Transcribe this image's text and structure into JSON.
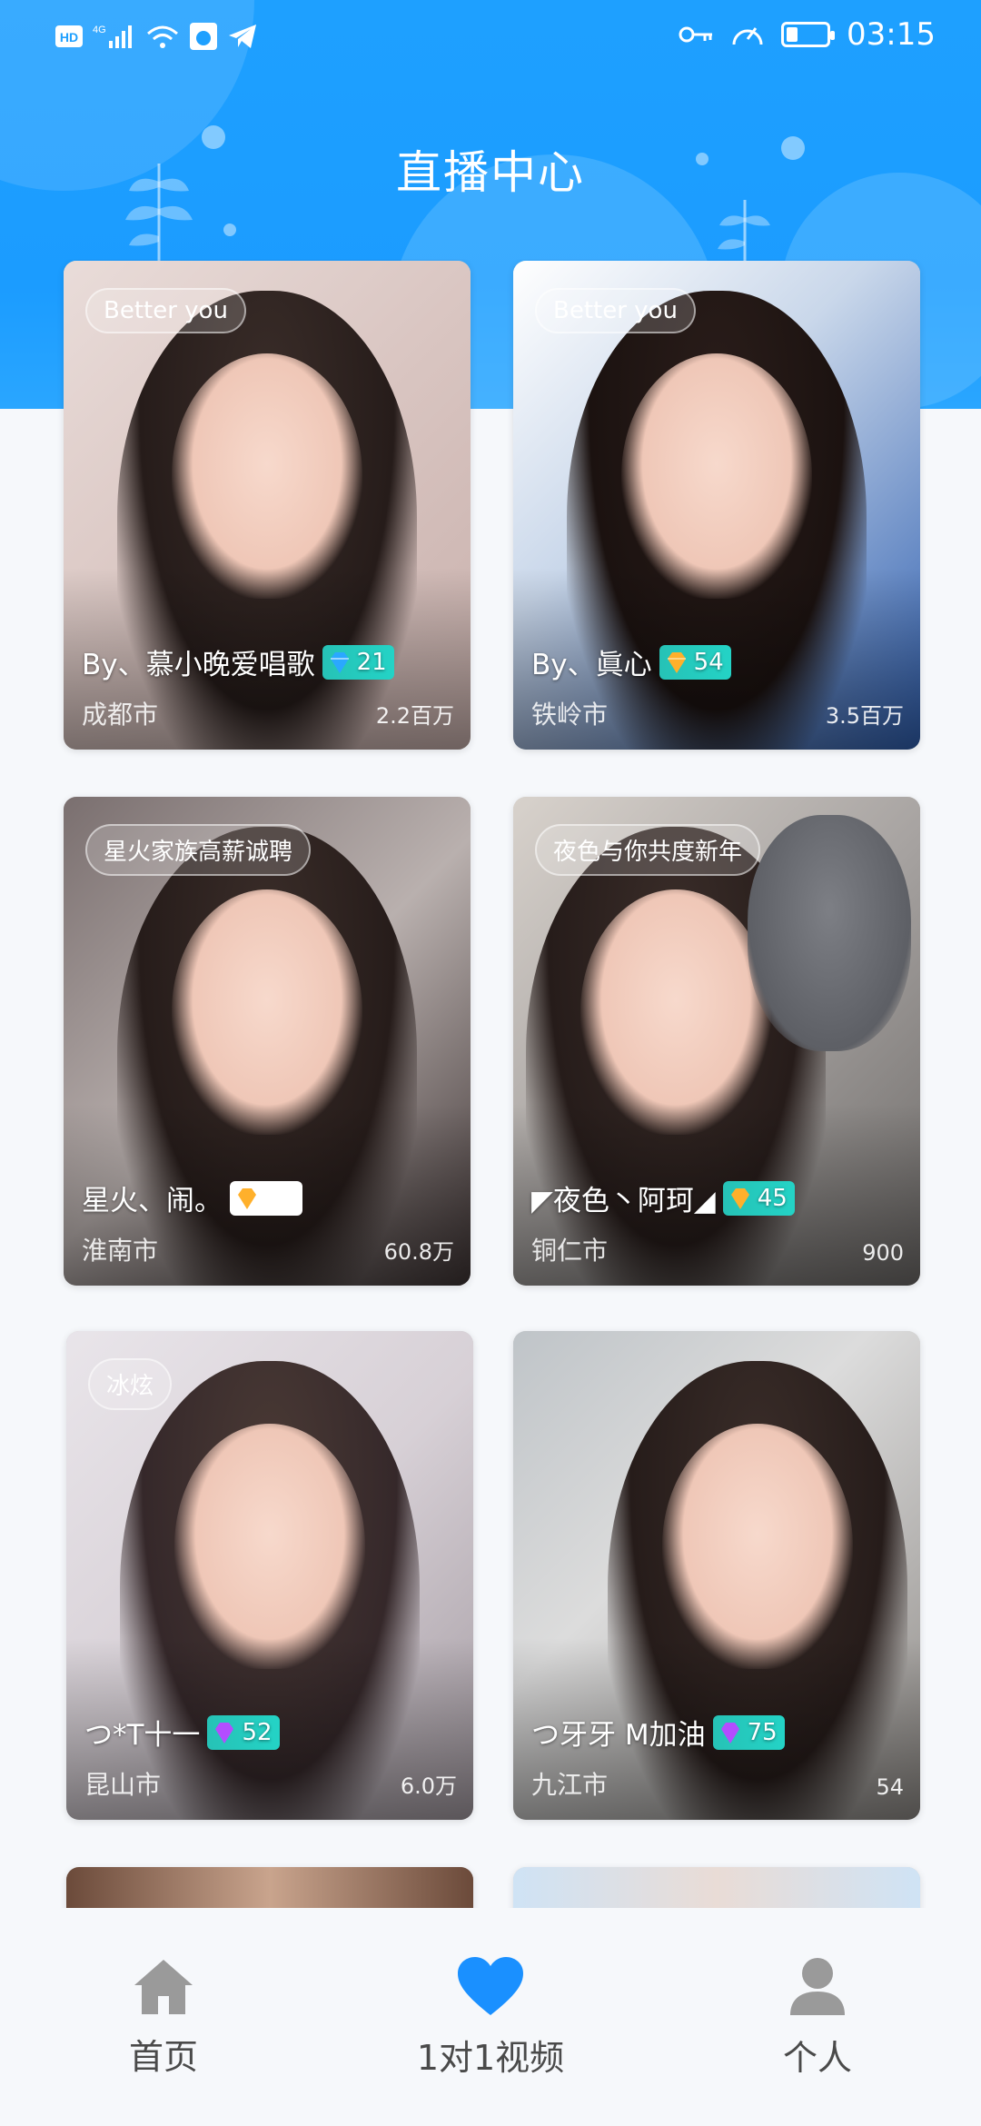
{
  "status_bar": {
    "time": "03:15",
    "left_icons": [
      "hd-icon",
      "4g-signal-icon",
      "wifi-icon",
      "app-notification-icon",
      "telegram-icon"
    ],
    "right_icons": [
      "key-icon",
      "speed-icon",
      "battery-icon"
    ]
  },
  "header": {
    "title": "直播中心"
  },
  "cards": [
    {
      "tag": "Better you",
      "name": "By、慕小晚爱唱歌",
      "level": "21",
      "city": "成都市",
      "viewers": "2.2百万",
      "gem_color": "#2aa8ff"
    },
    {
      "tag": "Better you",
      "name": "By、眞心",
      "level": "54",
      "city": "铁岭市",
      "viewers": "3.5百万",
      "gem_color": "#ffb02b"
    },
    {
      "tag": "星火家族高薪诚聘",
      "name": "星火、闹。",
      "level": "",
      "city": "淮南市",
      "viewers": "60.8万",
      "gem_color": "#ffb02b"
    },
    {
      "tag": "夜色与你共度新年",
      "name": "◤夜色丶阿珂◢",
      "level": "45",
      "city": "铜仁市",
      "viewers": "900",
      "gem_color": "#ffb02b"
    },
    {
      "tag": "冰炫",
      "name": "つ*T十一",
      "level": "52",
      "city": "昆山市",
      "viewers": "6.0万",
      "gem_color": "#b34dff"
    },
    {
      "tag": "",
      "name": "つ牙牙 M加油",
      "level": "75",
      "city": "九江市",
      "viewers": "54",
      "gem_color": "#b34dff"
    }
  ],
  "bottom_nav": {
    "items": [
      {
        "label": "首页",
        "icon": "home-icon",
        "color": "#9a9a9a"
      },
      {
        "label": "1对1视频",
        "icon": "heart-icon",
        "color": "#1a90ff"
      },
      {
        "label": "个人",
        "icon": "person-icon",
        "color": "#9a9a9a"
      }
    ]
  }
}
